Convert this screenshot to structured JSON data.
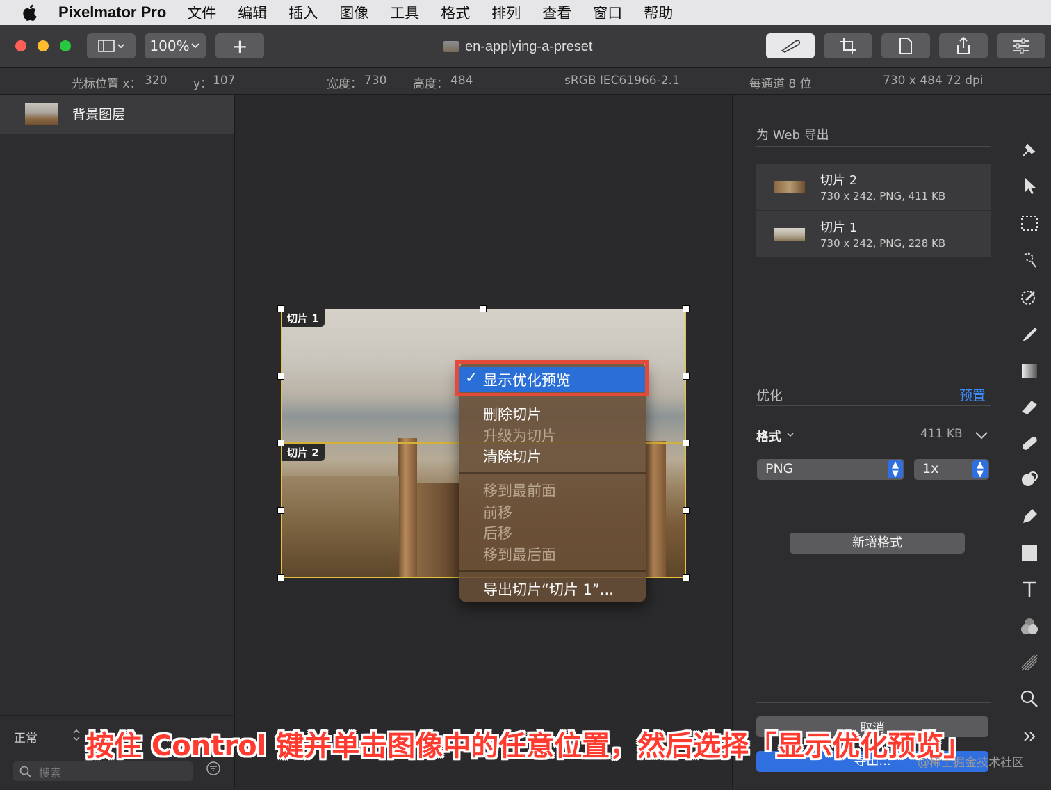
{
  "menubar": {
    "app_name": "Pixelmator Pro",
    "items": [
      "文件",
      "编辑",
      "插入",
      "图像",
      "工具",
      "格式",
      "排列",
      "查看",
      "窗口",
      "帮助"
    ]
  },
  "toolbar": {
    "zoom": "100%",
    "add": "+",
    "document_title": "en-applying-a-preset"
  },
  "infobar": {
    "cursor_x_label": "光标位置 x：",
    "cursor_x": "320",
    "cursor_y_label": "y：",
    "cursor_y": "107",
    "width_label": "宽度：",
    "width": "730",
    "height_label": "高度：",
    "height": "484",
    "color_profile": "sRGB IEC61966-2.1",
    "bit_depth": "每通道 8 位",
    "dimensions": "730 x 484 72 dpi"
  },
  "layers": {
    "items": [
      {
        "name": "背景图层"
      }
    ],
    "blend_mode": "正常",
    "search_placeholder": "搜索"
  },
  "canvas": {
    "slice1_label": "切片 1",
    "slice2_label": "切片 2"
  },
  "context_menu": {
    "checkmark": "✓",
    "items": [
      {
        "label": "显示优化预览",
        "checked": true,
        "enabled": true
      },
      {
        "label": "删除切片",
        "enabled": true
      },
      {
        "label": "升级为切片",
        "enabled": false
      },
      {
        "label": "清除切片",
        "enabled": true
      },
      {
        "label": "移到最前面",
        "enabled": false
      },
      {
        "label": "前移",
        "enabled": false
      },
      {
        "label": "后移",
        "enabled": false
      },
      {
        "label": "移到最后面",
        "enabled": false
      },
      {
        "label": "导出切片“切片 1”...",
        "enabled": true
      }
    ]
  },
  "export_panel": {
    "title": "为 Web 导出",
    "slices": [
      {
        "name": "切片 2",
        "details": "730 x 242, PNG, 411 KB"
      },
      {
        "name": "切片 1",
        "details": "730 x 242, PNG, 228 KB"
      }
    ],
    "optimize_label": "优化",
    "preset_link": "预置",
    "format_label": "格式",
    "format_size": "411 KB",
    "format_value": "PNG",
    "scale_value": "1x",
    "add_format": "新增格式",
    "cancel": "取消",
    "export": "导出..."
  },
  "caption": "按住 Control 键并单击图像中的任意位置，然后选择「显示优化预览」",
  "watermark": "@稀土掘金技术社区",
  "colors": {
    "accent": "#2f6fe0",
    "highlight_box": "#e34a3a",
    "caption": "#ff3b2f"
  }
}
